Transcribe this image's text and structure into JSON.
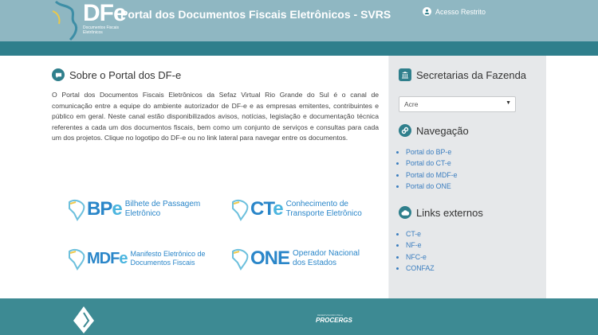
{
  "header": {
    "logo_text": "DFe",
    "logo_subtitle": "Documentos Fiscais Eletrônicos",
    "title": "Portal dos Documentos Fiscais Eletrônicos - SVRS",
    "login_label": "Acesso Restrito",
    "login_icon": "user-icon"
  },
  "about": {
    "heading": "Sobre o Portal dos DF-e",
    "heading_icon": "comment-icon",
    "text": "O Portal dos Documentos Fiscais Eletrônicos da Sefaz Virtual Rio Grande do Sul é o canal de comunicação entre a equipe do ambiente autorizador de DF-e e as empresas emitentes, contribuintes e público em geral. Neste canal estão disponibilizados avisos, notícias, legislação e documentação técnica referentes a cada um dos documentos fiscais, bem como um conjunto de serviços e consultas para cada um dos projetos. Clique no logotipo do DF-e ou no link lateral para navegar entre os documentos."
  },
  "projects": [
    {
      "abbr_a": "BP",
      "abbr_b": "e",
      "desc1": "Bilhete de Passagem",
      "desc2": "Eletrônico"
    },
    {
      "abbr_a": "CT",
      "abbr_b": "e",
      "desc1": "Conhecimento de",
      "desc2": "Transporte Eletrônico"
    },
    {
      "abbr_a": "MDF",
      "abbr_b": "e",
      "desc1": "Manifesto Eletrônico de",
      "desc2": "Documentos Fiscais"
    },
    {
      "abbr_a": "ONE",
      "abbr_b": "",
      "desc1": "Operador Nacional",
      "desc2": "dos Estados"
    }
  ],
  "sidebar": {
    "secretarias": {
      "heading": "Secretarias da Fazenda",
      "icon": "bank-icon",
      "selected": "Acre"
    },
    "navegacao": {
      "heading": "Navegação",
      "icon": "link-icon",
      "items": [
        "Portal do BP-e",
        "Portal do CT-e",
        "Portal do MDF-e",
        "Portal do ONE"
      ]
    },
    "links": {
      "heading": "Links externos",
      "icon": "cloud-icon",
      "items": [
        "CT-e",
        "NF-e",
        "NFC-e",
        "CONFAZ"
      ]
    }
  },
  "footer": {
    "developed_by": "DESENVOLVIDO PELA",
    "company": "PROCERGS"
  },
  "colors": {
    "header": "#8fb7c2",
    "header_bar": "#2f7f8c",
    "footer": "#3d8a93",
    "link": "#3a7dbf",
    "logo_blue": "#2a86c9"
  }
}
